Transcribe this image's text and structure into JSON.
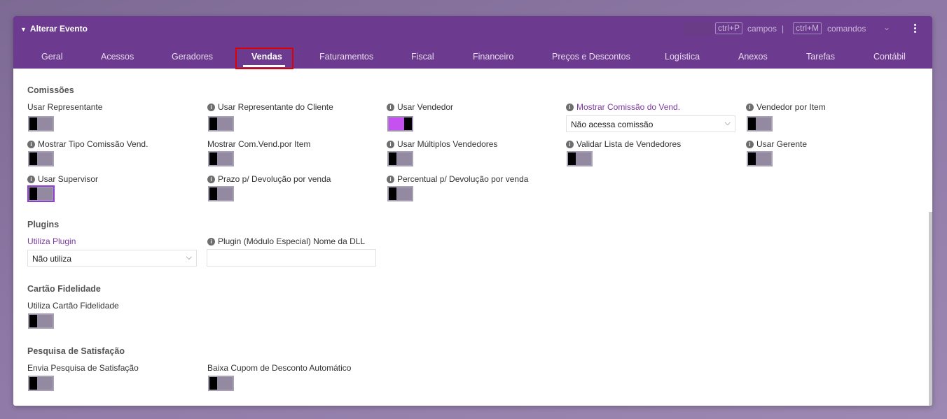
{
  "window": {
    "title": "Alterar Evento",
    "shortcuts": {
      "fields_key": "ctrl+P",
      "fields_label": "campos",
      "separator": "|",
      "commands_key": "ctrl+M",
      "commands_label": "comandos"
    }
  },
  "tabs": [
    "Geral",
    "Acessos",
    "Geradores",
    "Vendas",
    "Faturamentos",
    "Fiscal",
    "Financeiro",
    "Preços e Descontos",
    "Logística",
    "Anexos",
    "Tarefas",
    "Contábil"
  ],
  "active_tab": "Vendas",
  "sections": {
    "comissoes": {
      "title": "Comissões",
      "fields": {
        "usar_representante": {
          "label": "Usar Representante",
          "value": false
        },
        "usar_representante_cliente": {
          "label": "Usar Representante do Cliente",
          "value": false
        },
        "usar_vendedor": {
          "label": "Usar Vendedor",
          "value": true
        },
        "mostrar_comissao_vend": {
          "label": "Mostrar Comissão do Vend.",
          "value": "Não acessa comissão"
        },
        "vendedor_por_item": {
          "label": "Vendedor por Item",
          "value": false
        },
        "mostrar_tipo_comissao": {
          "label": "Mostrar Tipo Comissão Vend.",
          "value": false
        },
        "mostrar_com_vend_item": {
          "label": "Mostrar Com.Vend.por Item",
          "value": false
        },
        "usar_multiplos_vendedores": {
          "label": "Usar Múltiplos Vendedores",
          "value": false
        },
        "validar_lista_vendedores": {
          "label": "Validar Lista de Vendedores",
          "value": false
        },
        "usar_gerente": {
          "label": "Usar Gerente",
          "value": false
        },
        "usar_supervisor": {
          "label": "Usar Supervisor",
          "value": false
        },
        "prazo_devolucao": {
          "label": "Prazo p/ Devolução por venda",
          "value": false
        },
        "percentual_devolucao": {
          "label": "Percentual p/ Devolução por venda",
          "value": false
        }
      }
    },
    "plugins": {
      "title": "Plugins",
      "utiliza_plugin": {
        "label": "Utiliza Plugin",
        "value": "Não utiliza"
      },
      "plugin_dll": {
        "label": "Plugin (Módulo Especial) Nome da DLL",
        "value": ""
      }
    },
    "cartao": {
      "title": "Cartão Fidelidade",
      "utiliza_cartao": {
        "label": "Utiliza Cartão Fidelidade",
        "value": false
      }
    },
    "pesquisa": {
      "title": "Pesquisa de Satisfação",
      "envia_pesquisa": {
        "label": "Envia Pesquisa de Satisfação",
        "value": false
      },
      "baixa_cupom": {
        "label": "Baixa Cupom de Desconto Automático",
        "value": false
      }
    }
  },
  "colors": {
    "header": "#6c3a8e",
    "toggle_on": "#c552f0",
    "focus": "#e00000"
  }
}
